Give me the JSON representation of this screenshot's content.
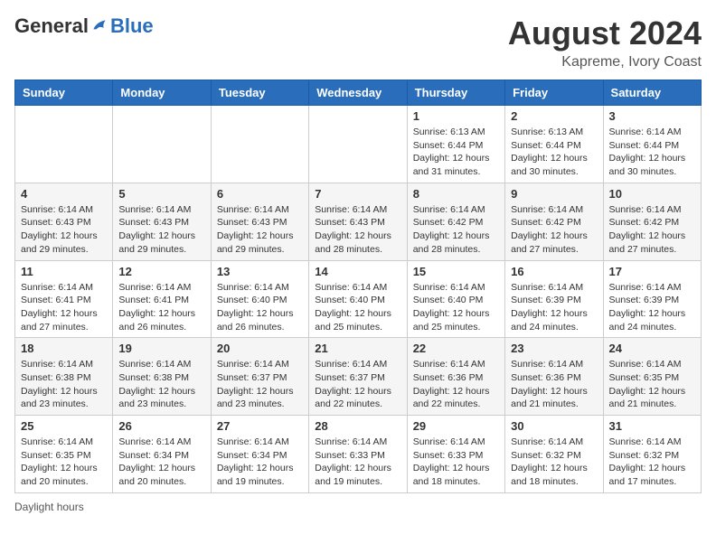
{
  "header": {
    "logo_general": "General",
    "logo_blue": "Blue",
    "month_year": "August 2024",
    "location": "Kapreme, Ivory Coast"
  },
  "footer": {
    "daylight_hours": "Daylight hours"
  },
  "days_of_week": [
    "Sunday",
    "Monday",
    "Tuesday",
    "Wednesday",
    "Thursday",
    "Friday",
    "Saturday"
  ],
  "weeks": [
    [
      {
        "day": "",
        "info": ""
      },
      {
        "day": "",
        "info": ""
      },
      {
        "day": "",
        "info": ""
      },
      {
        "day": "",
        "info": ""
      },
      {
        "day": "1",
        "info": "Sunrise: 6:13 AM\nSunset: 6:44 PM\nDaylight: 12 hours and 31 minutes."
      },
      {
        "day": "2",
        "info": "Sunrise: 6:13 AM\nSunset: 6:44 PM\nDaylight: 12 hours and 30 minutes."
      },
      {
        "day": "3",
        "info": "Sunrise: 6:14 AM\nSunset: 6:44 PM\nDaylight: 12 hours and 30 minutes."
      }
    ],
    [
      {
        "day": "4",
        "info": "Sunrise: 6:14 AM\nSunset: 6:43 PM\nDaylight: 12 hours and 29 minutes."
      },
      {
        "day": "5",
        "info": "Sunrise: 6:14 AM\nSunset: 6:43 PM\nDaylight: 12 hours and 29 minutes."
      },
      {
        "day": "6",
        "info": "Sunrise: 6:14 AM\nSunset: 6:43 PM\nDaylight: 12 hours and 29 minutes."
      },
      {
        "day": "7",
        "info": "Sunrise: 6:14 AM\nSunset: 6:43 PM\nDaylight: 12 hours and 28 minutes."
      },
      {
        "day": "8",
        "info": "Sunrise: 6:14 AM\nSunset: 6:42 PM\nDaylight: 12 hours and 28 minutes."
      },
      {
        "day": "9",
        "info": "Sunrise: 6:14 AM\nSunset: 6:42 PM\nDaylight: 12 hours and 27 minutes."
      },
      {
        "day": "10",
        "info": "Sunrise: 6:14 AM\nSunset: 6:42 PM\nDaylight: 12 hours and 27 minutes."
      }
    ],
    [
      {
        "day": "11",
        "info": "Sunrise: 6:14 AM\nSunset: 6:41 PM\nDaylight: 12 hours and 27 minutes."
      },
      {
        "day": "12",
        "info": "Sunrise: 6:14 AM\nSunset: 6:41 PM\nDaylight: 12 hours and 26 minutes."
      },
      {
        "day": "13",
        "info": "Sunrise: 6:14 AM\nSunset: 6:40 PM\nDaylight: 12 hours and 26 minutes."
      },
      {
        "day": "14",
        "info": "Sunrise: 6:14 AM\nSunset: 6:40 PM\nDaylight: 12 hours and 25 minutes."
      },
      {
        "day": "15",
        "info": "Sunrise: 6:14 AM\nSunset: 6:40 PM\nDaylight: 12 hours and 25 minutes."
      },
      {
        "day": "16",
        "info": "Sunrise: 6:14 AM\nSunset: 6:39 PM\nDaylight: 12 hours and 24 minutes."
      },
      {
        "day": "17",
        "info": "Sunrise: 6:14 AM\nSunset: 6:39 PM\nDaylight: 12 hours and 24 minutes."
      }
    ],
    [
      {
        "day": "18",
        "info": "Sunrise: 6:14 AM\nSunset: 6:38 PM\nDaylight: 12 hours and 23 minutes."
      },
      {
        "day": "19",
        "info": "Sunrise: 6:14 AM\nSunset: 6:38 PM\nDaylight: 12 hours and 23 minutes."
      },
      {
        "day": "20",
        "info": "Sunrise: 6:14 AM\nSunset: 6:37 PM\nDaylight: 12 hours and 23 minutes."
      },
      {
        "day": "21",
        "info": "Sunrise: 6:14 AM\nSunset: 6:37 PM\nDaylight: 12 hours and 22 minutes."
      },
      {
        "day": "22",
        "info": "Sunrise: 6:14 AM\nSunset: 6:36 PM\nDaylight: 12 hours and 22 minutes."
      },
      {
        "day": "23",
        "info": "Sunrise: 6:14 AM\nSunset: 6:36 PM\nDaylight: 12 hours and 21 minutes."
      },
      {
        "day": "24",
        "info": "Sunrise: 6:14 AM\nSunset: 6:35 PM\nDaylight: 12 hours and 21 minutes."
      }
    ],
    [
      {
        "day": "25",
        "info": "Sunrise: 6:14 AM\nSunset: 6:35 PM\nDaylight: 12 hours and 20 minutes."
      },
      {
        "day": "26",
        "info": "Sunrise: 6:14 AM\nSunset: 6:34 PM\nDaylight: 12 hours and 20 minutes."
      },
      {
        "day": "27",
        "info": "Sunrise: 6:14 AM\nSunset: 6:34 PM\nDaylight: 12 hours and 19 minutes."
      },
      {
        "day": "28",
        "info": "Sunrise: 6:14 AM\nSunset: 6:33 PM\nDaylight: 12 hours and 19 minutes."
      },
      {
        "day": "29",
        "info": "Sunrise: 6:14 AM\nSunset: 6:33 PM\nDaylight: 12 hours and 18 minutes."
      },
      {
        "day": "30",
        "info": "Sunrise: 6:14 AM\nSunset: 6:32 PM\nDaylight: 12 hours and 18 minutes."
      },
      {
        "day": "31",
        "info": "Sunrise: 6:14 AM\nSunset: 6:32 PM\nDaylight: 12 hours and 17 minutes."
      }
    ]
  ]
}
